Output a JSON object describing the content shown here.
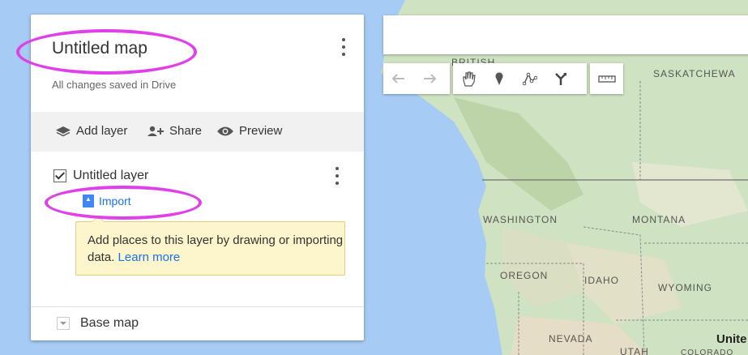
{
  "map": {
    "labels": {
      "british": "BRITISH",
      "saskatchewan": "SASKATCHEWA",
      "washington": "WASHINGTON",
      "montana": "MONTANA",
      "oregon": "OREGON",
      "idaho": "IDAHO",
      "wyoming": "WYOMING",
      "nevada": "NEVADA",
      "utah": "UTAH",
      "colorado": "COLORADO",
      "united": "Unite"
    }
  },
  "panel": {
    "title": "Untitled map",
    "saved_status": "All changes saved in Drive",
    "actions": {
      "add_layer": "Add layer",
      "share": "Share",
      "preview": "Preview"
    },
    "layer": {
      "name": "Untitled layer",
      "checked": true,
      "import_label": "Import",
      "tip_text": "Add places to this layer by drawing or importing data.",
      "tip_link": "Learn more"
    },
    "base_map": "Base map"
  },
  "toolbar": {
    "icons": [
      "undo-icon",
      "redo-icon",
      "hand-icon",
      "marker-icon",
      "line-icon",
      "directions-icon",
      "ruler-icon"
    ]
  },
  "colors": {
    "highlight": "#e040e8",
    "link": "#1a73e8",
    "tooltip_bg": "#fdf5cb",
    "water": "#a6cbf5",
    "land": "#cfe2c2"
  }
}
